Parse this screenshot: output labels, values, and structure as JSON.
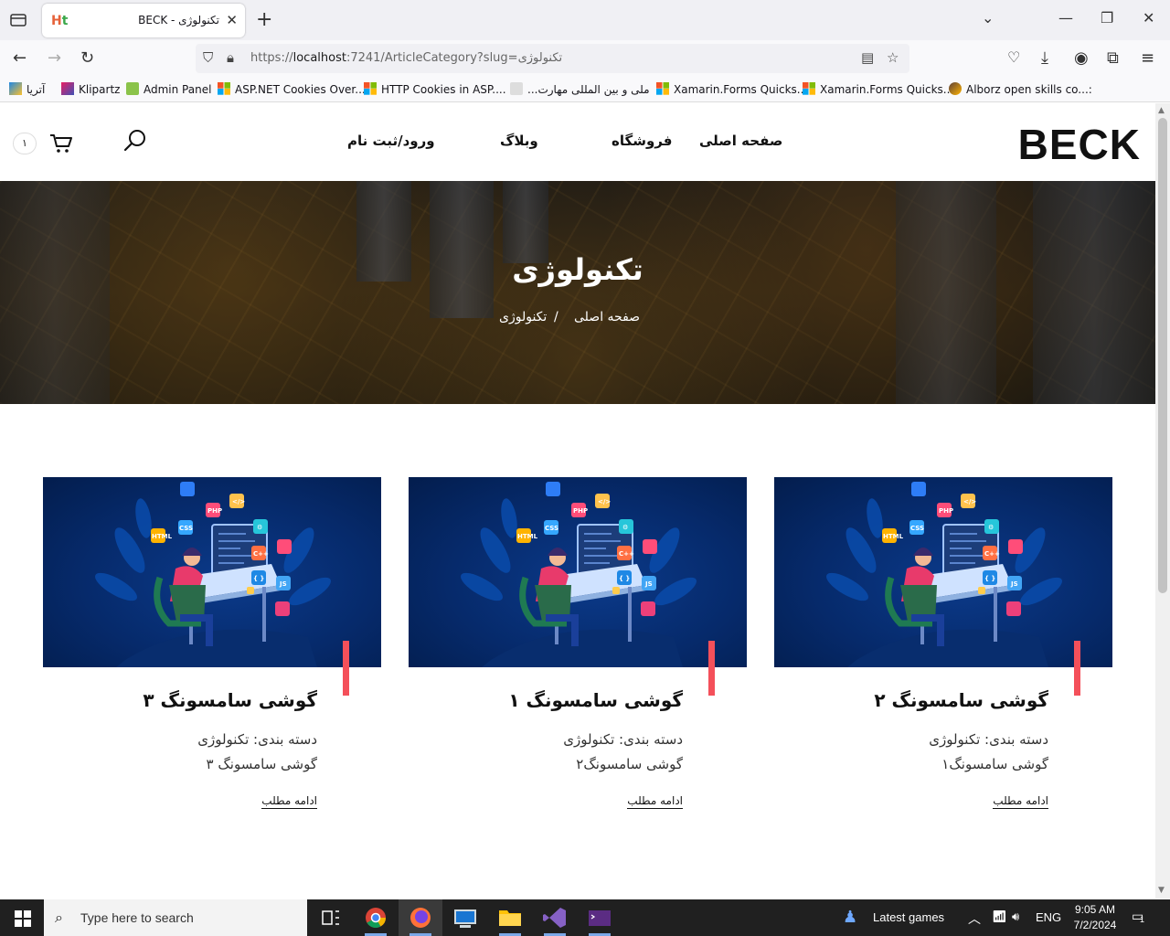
{
  "browser": {
    "tab_title": "تکنولوژی - BECK",
    "url_prefix": "https://",
    "url_host": "localhost",
    "url_rest": ":7241/ArticleCategory?slug=تکنولوژی",
    "bookmarks": [
      {
        "label": "آتریا"
      },
      {
        "label": "Klipartz"
      },
      {
        "label": "Admin Panel"
      },
      {
        "label": "ASP.NET Cookies Over..."
      },
      {
        "label": "HTTP Cookies in ASP...."
      },
      {
        "label": "...ملی و بین المللی مهارت"
      },
      {
        "label": "Xamarin.Forms Quicks..."
      },
      {
        "label": "Xamarin.Forms Quicks..."
      },
      {
        "label": "Alborz open skills co...:"
      }
    ]
  },
  "site": {
    "logo": "BECK",
    "menu": {
      "home": "صفحه اصلی",
      "shop": "فروشگاه",
      "blog": "وبلاگ",
      "login": "ورود/ثبت نام"
    },
    "cart_count": "۱"
  },
  "hero": {
    "title": "تکنولوژی",
    "breadcrumb_home": "صفحه اصلی",
    "breadcrumb_sep": "/",
    "breadcrumb_current": "تکنولوژی"
  },
  "articles": [
    {
      "title": "گوشی سامسونگ ۲",
      "category": "دسته بندی: تکنولوژی",
      "description": "گوشی سامسونگ۱",
      "more": "ادامه مطلب"
    },
    {
      "title": "گوشی سامسونگ ۱",
      "category": "دسته بندی: تکنولوژی",
      "description": "گوشی سامسونگ۲",
      "more": "ادامه مطلب"
    },
    {
      "title": "گوشی سامسونگ ۳",
      "category": "دسته بندی: تکنولوژی",
      "description": "گوشی سامسونگ ۳",
      "more": "ادامه مطلب"
    }
  ],
  "taskbar": {
    "search_placeholder": "Type here to search",
    "news": "Latest games",
    "lang": "ENG",
    "time": "9:05 AM",
    "date": "7/2/2024",
    "notif_count": "1"
  }
}
